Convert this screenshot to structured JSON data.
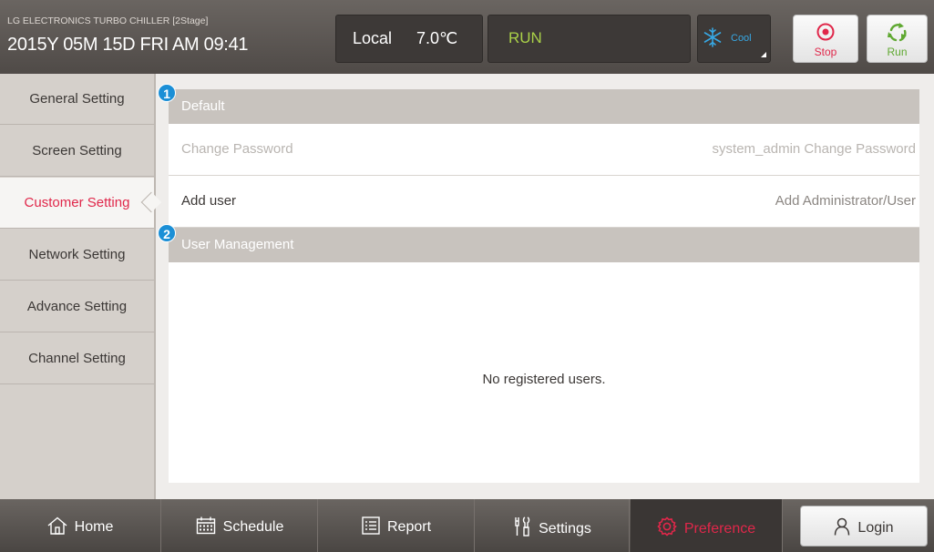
{
  "header": {
    "model": "LG ELECTRONICS TURBO CHILLER [2Stage]",
    "datetime": "2015Y 05M 15D  FRI AM 09:41",
    "control_mode": "Local",
    "temperature": "7.0℃",
    "run_status": "RUN",
    "operation_mode": "Cool",
    "stop_label": "Stop",
    "run_label": "Run",
    "colors": {
      "run_status": "#aad148",
      "cool": "#37a8e4",
      "stop": "#e0274a",
      "run": "#5fa831"
    }
  },
  "sidebar": {
    "items": [
      {
        "label": "General Setting"
      },
      {
        "label": "Screen Setting"
      },
      {
        "label": "Customer Setting",
        "active": true
      },
      {
        "label": "Network Setting"
      },
      {
        "label": "Advance Setting"
      },
      {
        "label": "Channel Setting"
      }
    ]
  },
  "main": {
    "sections": [
      {
        "badge": "1",
        "title": "Default",
        "rows": [
          {
            "label": "Change Password",
            "value": "system_admin Change Password",
            "enabled": false
          },
          {
            "label": "Add user",
            "value": "Add Administrator/User",
            "enabled": true
          }
        ]
      },
      {
        "badge": "2",
        "title": "User Management"
      }
    ],
    "empty_message": "No registered users."
  },
  "bottom_nav": {
    "items": [
      {
        "label": "Home",
        "icon": "home-icon"
      },
      {
        "label": "Schedule",
        "icon": "calendar-icon"
      },
      {
        "label": "Report",
        "icon": "report-icon"
      },
      {
        "label": "Settings",
        "icon": "tools-icon"
      },
      {
        "label": "Preference",
        "icon": "gear-icon",
        "active": true
      }
    ],
    "login_label": "Login",
    "accent": "#e0274a"
  }
}
